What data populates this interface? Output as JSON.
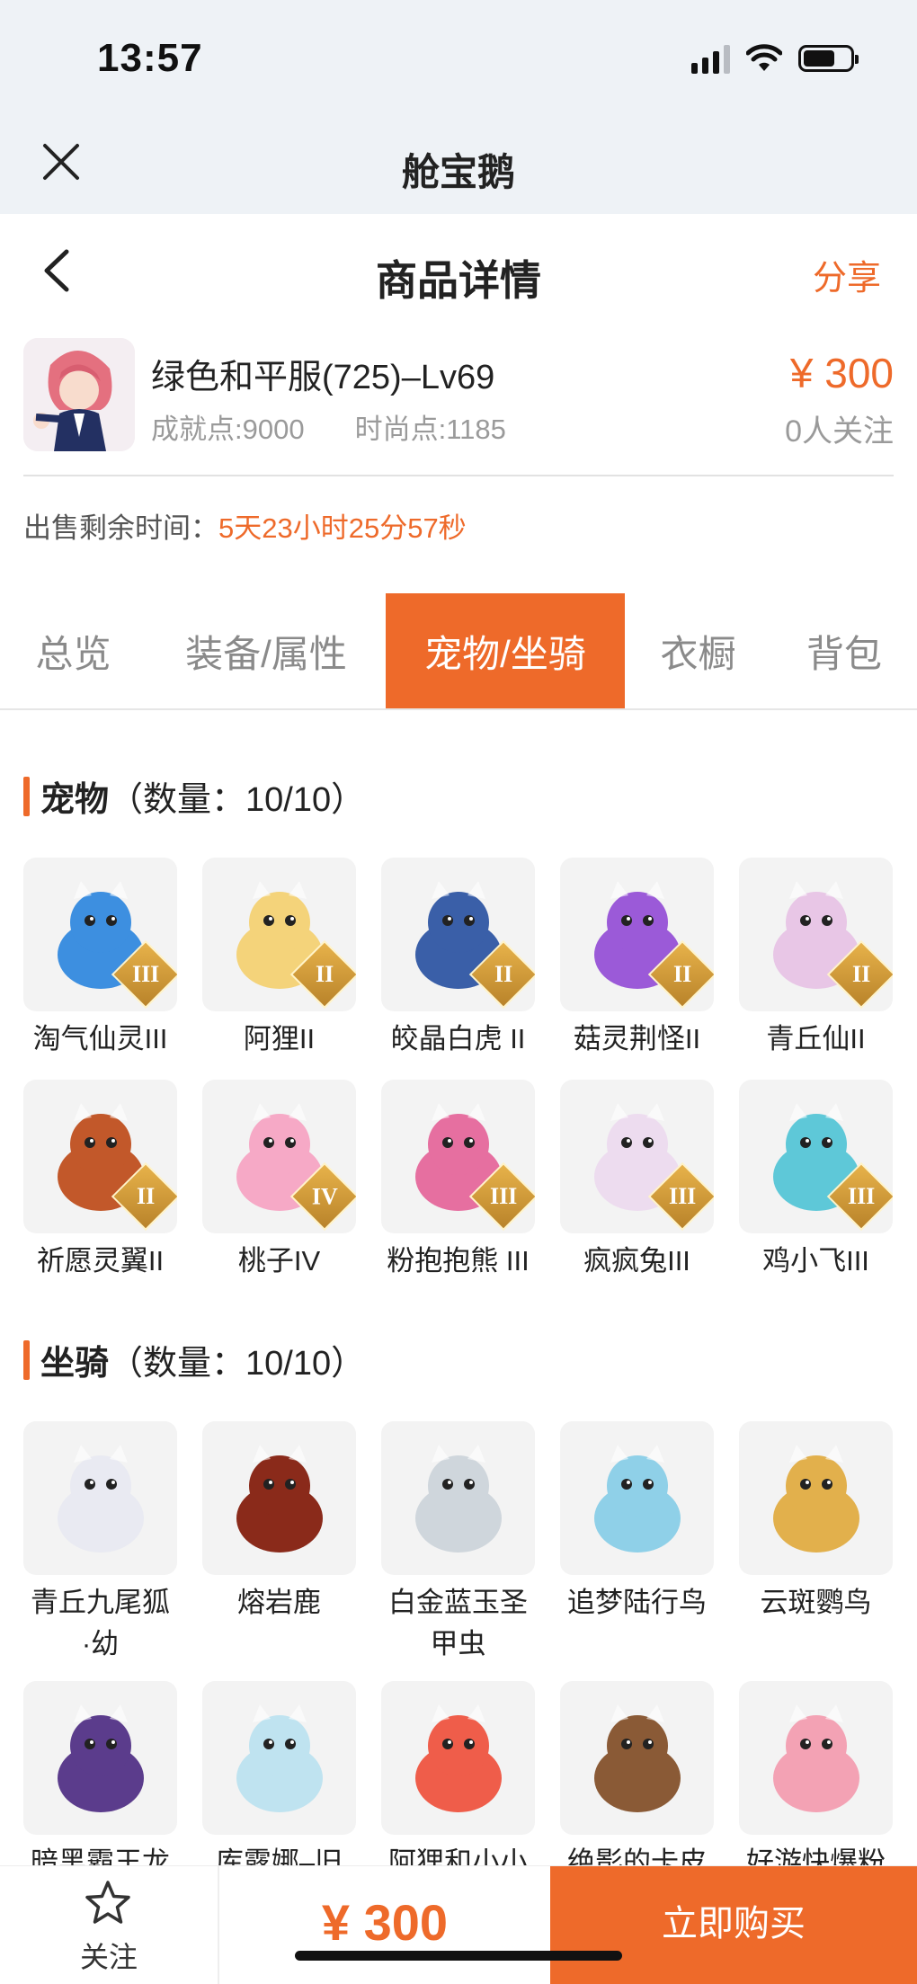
{
  "status_bar": {
    "time": "13:57"
  },
  "app_header": {
    "title": "舱宝鹅"
  },
  "nav": {
    "title": "商品详情",
    "share": "分享"
  },
  "product": {
    "name": "绿色和平服(725)–Lv69",
    "achievement": "成就点:9000",
    "fashion": "时尚点:1185",
    "price": "¥ 300",
    "followers": "0人关注"
  },
  "sale": {
    "label": "出售剩余时间：",
    "remaining": "5天23小时25分57秒"
  },
  "tabs": [
    "总览",
    "装备/属性",
    "宠物/坐骑",
    "衣橱",
    "背包"
  ],
  "active_tab": "宠物/坐骑",
  "pets": {
    "title": "宠物",
    "count": "（数量：10/10）",
    "items": [
      {
        "name": "淘气仙灵III",
        "tier": "III",
        "color": "#3d8fe0"
      },
      {
        "name": "阿狸II",
        "tier": "II",
        "color": "#f4d37a"
      },
      {
        "name": "皎晶白虎 II",
        "tier": "II",
        "color": "#3a5fa8"
      },
      {
        "name": "菇灵荆怪II",
        "tier": "II",
        "color": "#9b5ad8"
      },
      {
        "name": "青丘仙II",
        "tier": "II",
        "color": "#e8c6e6"
      },
      {
        "name": "祈愿灵翼II",
        "tier": "II",
        "color": "#c2582a"
      },
      {
        "name": "桃子IV",
        "tier": "IV",
        "color": "#f6a9c6"
      },
      {
        "name": "粉抱抱熊 III",
        "tier": "III",
        "color": "#e66fa0"
      },
      {
        "name": "疯疯兔III",
        "tier": "III",
        "color": "#eddcef"
      },
      {
        "name": "鸡小飞III",
        "tier": "III",
        "color": "#5ec8d8"
      }
    ]
  },
  "mounts": {
    "title": "坐骑",
    "count": "（数量：10/10）",
    "items": [
      {
        "name": "青丘九尾狐\n·幼",
        "color": "#e9eaf2"
      },
      {
        "name": "熔岩鹿",
        "color": "#8a2a1a"
      },
      {
        "name": "白金蓝玉圣\n甲虫",
        "color": "#cfd6dc"
      },
      {
        "name": "追梦陆行鸟",
        "color": "#8fd0e8"
      },
      {
        "name": "云斑鹦鸟",
        "color": "#e2b04c"
      },
      {
        "name": "暗黑霸王龙",
        "color": "#5b3c8c"
      },
      {
        "name": "库露娜–旧",
        "color": "#bfe3f0"
      },
      {
        "name": "阿狸和小小",
        "color": "#ef5d4a"
      },
      {
        "name": "绝影的卡皮",
        "color": "#8a5a36"
      },
      {
        "name": "好游快爆粉",
        "color": "#f3a2b4"
      }
    ]
  },
  "bottom_bar": {
    "follow": "关注",
    "price": "¥ 300",
    "buy": "立即购买"
  },
  "colors": {
    "accent": "#ee6a2a"
  }
}
